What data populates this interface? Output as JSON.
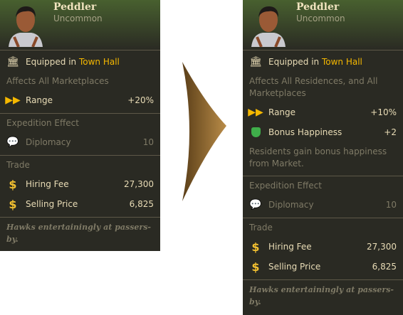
{
  "before": {
    "name": "Peddler",
    "rarity": "Uncommon",
    "equipped_prefix": "Equipped in",
    "building": "Town Hall",
    "affects": "Affects All Marketplaces",
    "stats": [
      {
        "icon": "range-icon",
        "label": "Range",
        "value": "+20%"
      }
    ],
    "expedition_title": "Expedition Effect",
    "expedition": {
      "icon": "diplomacy-icon",
      "label": "Diplomacy",
      "value": "10"
    },
    "trade_title": "Trade",
    "hiring_label": "Hiring Fee",
    "hiring_value": "27,300",
    "selling_label": "Selling Price",
    "selling_value": "6,825",
    "flavor": "Hawks entertainingly at passers-by."
  },
  "after": {
    "name": "Peddler",
    "rarity": "Uncommon",
    "equipped_prefix": "Equipped in",
    "building": "Town Hall",
    "affects": "Affects All Residences, and All Marketplaces",
    "stats": [
      {
        "icon": "range-icon",
        "label": "Range",
        "value": "+10%"
      },
      {
        "icon": "happiness-mask-icon",
        "label": "Bonus Happiness",
        "value": "+2"
      }
    ],
    "description": "Residents gain bonus happiness from Market.",
    "expedition_title": "Expedition Effect",
    "expedition": {
      "icon": "diplomacy-icon",
      "label": "Diplomacy",
      "value": "10"
    },
    "trade_title": "Trade",
    "hiring_label": "Hiring Fee",
    "hiring_value": "27,300",
    "selling_label": "Selling Price",
    "selling_value": "6,825",
    "flavor": "Hawks entertainingly at passers-by."
  },
  "colors": {
    "panel": "#2a2a23",
    "highlight": "#f5b800",
    "arrow": "#a07838"
  }
}
